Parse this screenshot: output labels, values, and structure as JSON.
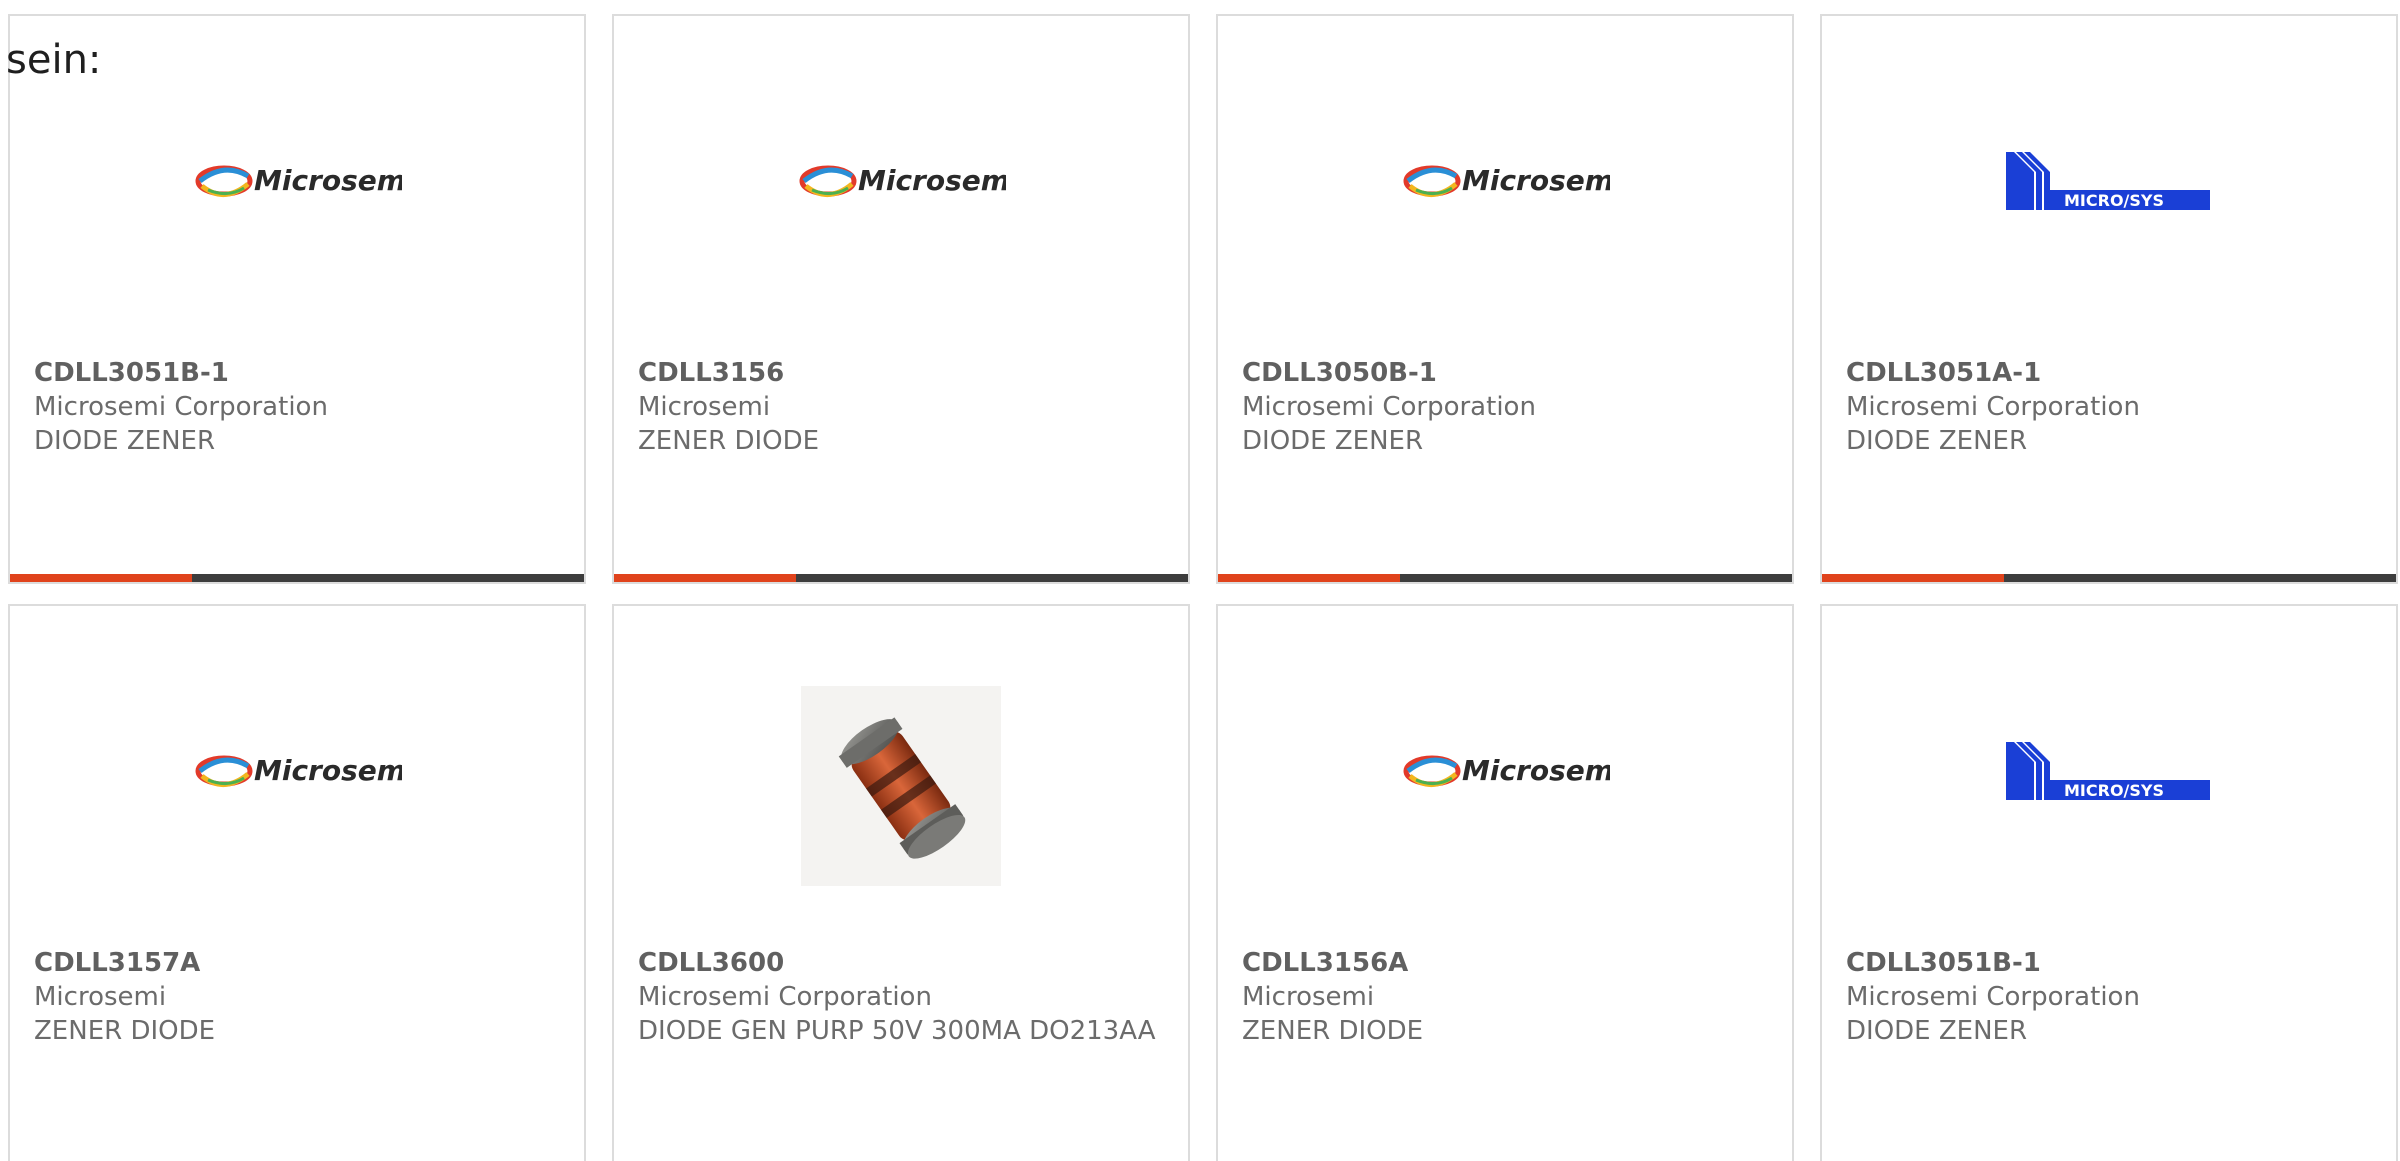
{
  "intro": "sein:",
  "colors": {
    "accent": "#e0431c",
    "bar_dark": "#3d3d3d",
    "microsemi_text": "#2a2a2a",
    "microsys_blue": "#1a3fd6"
  },
  "cards": [
    {
      "part": "CDLL3051B-1",
      "manufacturer": "Microsemi Corporation",
      "description": "DIODE ZENER",
      "image": "microsemi-logo"
    },
    {
      "part": "CDLL3156",
      "manufacturer": "Microsemi",
      "description": "ZENER DIODE",
      "image": "microsemi-logo"
    },
    {
      "part": "CDLL3050B-1",
      "manufacturer": "Microsemi Corporation",
      "description": "DIODE ZENER",
      "image": "microsemi-logo"
    },
    {
      "part": "CDLL3051A-1",
      "manufacturer": "Microsemi Corporation",
      "description": "DIODE ZENER",
      "image": "microsys-logo"
    },
    {
      "part": "CDLL3157A",
      "manufacturer": "Microsemi",
      "description": "ZENER DIODE",
      "image": "microsemi-logo"
    },
    {
      "part": "CDLL3600",
      "manufacturer": "Microsemi Corporation",
      "description": "DIODE GEN PURP 50V 300MA DO213AA",
      "image": "diode-photo"
    },
    {
      "part": "CDLL3156A",
      "manufacturer": "Microsemi",
      "description": "ZENER DIODE",
      "image": "microsemi-logo"
    },
    {
      "part": "CDLL3051B-1",
      "manufacturer": "Microsemi Corporation",
      "description": "DIODE ZENER",
      "image": "microsys-logo"
    }
  ],
  "logos": {
    "microsemi": "Microsemi",
    "microsys": "MICRO/SYS"
  }
}
